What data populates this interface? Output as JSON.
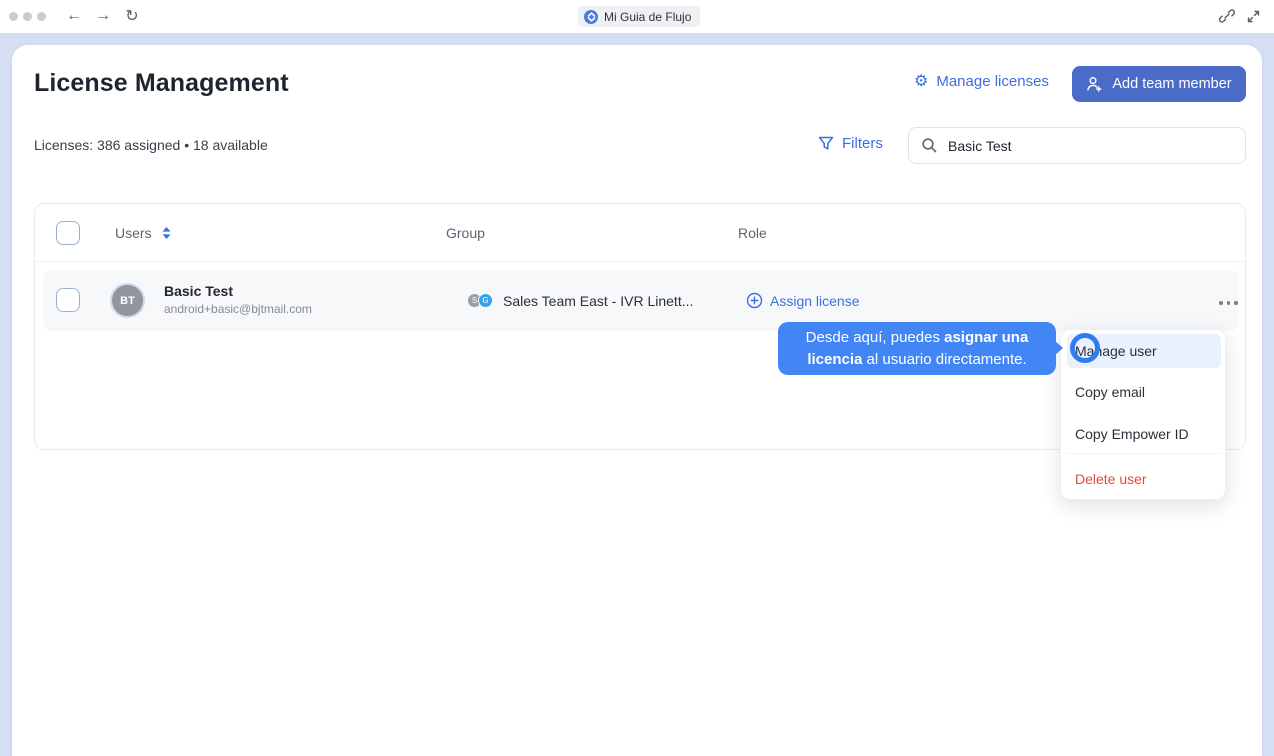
{
  "browser": {
    "tab_title": "Mi Guia de Flujo"
  },
  "header": {
    "title": "License Management",
    "manage_licenses": "Manage licenses",
    "add_team_member": "Add team member"
  },
  "toolbar": {
    "license_summary": "Licenses: 386 assigned • 18 available",
    "filters": "Filters",
    "search_value": "Basic Test"
  },
  "table": {
    "columns": [
      "Users",
      "Group",
      "Role"
    ],
    "rows": [
      {
        "initials": "BT",
        "name": "Basic Test",
        "email": "android+basic@bjtmail.com",
        "group_badges": [
          {
            "label": "S"
          },
          {
            "label": "G"
          }
        ],
        "group": "Sales Team East - IVR Linett...",
        "role_action": "Assign license"
      }
    ]
  },
  "tooltip": {
    "part1": "Desde aquí, puedes ",
    "bold": "asignar una licencia",
    "part2": " al usuario directamente."
  },
  "context_menu": {
    "items": [
      {
        "label": "Manage user"
      },
      {
        "label": "Copy email"
      },
      {
        "label": "Copy Empower ID"
      },
      {
        "label": "Delete user"
      }
    ]
  },
  "colors": {
    "accent": "#3D6EE0",
    "button": "#4A6CC8",
    "tooltip": "#4285F4",
    "danger": "#E14B40",
    "page_edge": "#D5DFF4"
  }
}
